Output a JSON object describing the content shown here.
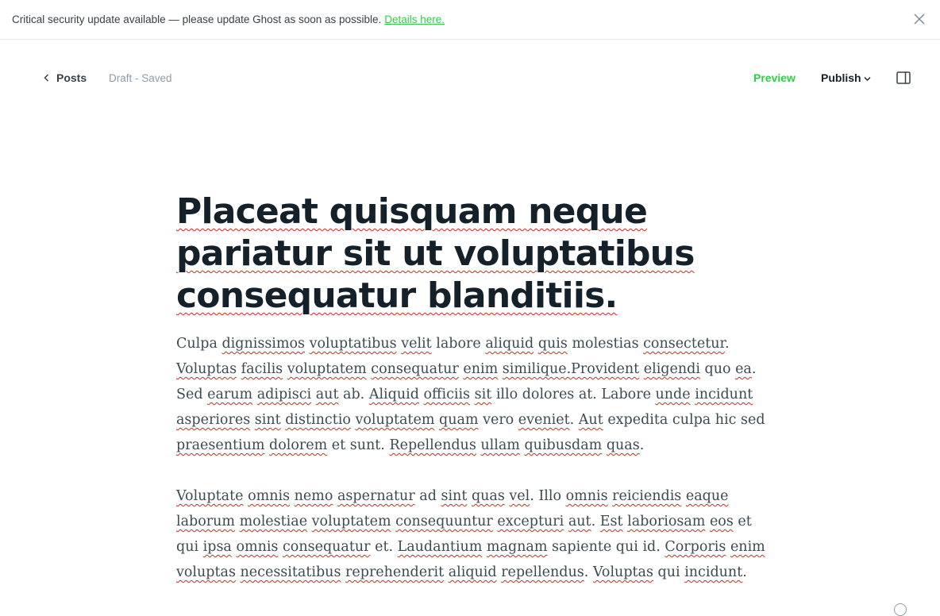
{
  "banner": {
    "message": "Critical security update available — please update Ghost as soon as possible.",
    "link_label": "Details here."
  },
  "header": {
    "back_label": "Posts",
    "status": "Draft - Saved",
    "preview_label": "Preview",
    "publish_label": "Publish"
  },
  "post": {
    "title": "Placeat quisquam neque pariatur sit ut voluptatibus consequatur blanditiis.",
    "paragraph1": [
      [
        "Culpa ",
        false
      ],
      [
        "dignissimos",
        true
      ],
      [
        " ",
        false
      ],
      [
        "voluptatibus",
        true
      ],
      [
        " ",
        false
      ],
      [
        "velit",
        true
      ],
      [
        " labore ",
        false
      ],
      [
        "aliquid",
        true
      ],
      [
        " ",
        false
      ],
      [
        "quis",
        true
      ],
      [
        " molestias ",
        false
      ],
      [
        "consectetur",
        true
      ],
      [
        ". ",
        false
      ],
      [
        "Voluptas",
        true
      ],
      [
        " ",
        false
      ],
      [
        "facilis",
        true
      ],
      [
        " ",
        false
      ],
      [
        "voluptatem",
        true
      ],
      [
        " ",
        false
      ],
      [
        "consequatur",
        true
      ],
      [
        " ",
        false
      ],
      [
        "enim",
        true
      ],
      [
        " ",
        false
      ],
      [
        "similique.Provident",
        true
      ],
      [
        " ",
        false
      ],
      [
        "eligendi",
        true
      ],
      [
        " quo ",
        false
      ],
      [
        "ea",
        true
      ],
      [
        ". Sed ",
        false
      ],
      [
        "earum",
        true
      ],
      [
        " ",
        false
      ],
      [
        "adipisci",
        true
      ],
      [
        " ",
        false
      ],
      [
        "aut",
        true
      ],
      [
        " ab. ",
        false
      ],
      [
        "Aliquid",
        true
      ],
      [
        " ",
        false
      ],
      [
        "officiis",
        true
      ],
      [
        " ",
        false
      ],
      [
        "sit",
        true
      ],
      [
        " illo dolores at. Labore ",
        false
      ],
      [
        "unde",
        true
      ],
      [
        " ",
        false
      ],
      [
        "incidunt",
        true
      ],
      [
        " ",
        false
      ],
      [
        "asperiores",
        true
      ],
      [
        " ",
        false
      ],
      [
        "sint",
        true
      ],
      [
        " ",
        false
      ],
      [
        "distinctio",
        true
      ],
      [
        " ",
        false
      ],
      [
        "voluptatem",
        true
      ],
      [
        " ",
        false
      ],
      [
        "quam",
        true
      ],
      [
        " vero ",
        false
      ],
      [
        "eveniet",
        true
      ],
      [
        ". ",
        false
      ],
      [
        "Aut",
        true
      ],
      [
        " expedita culpa hic sed ",
        false
      ],
      [
        "praesentium",
        true
      ],
      [
        " ",
        false
      ],
      [
        "dolorem",
        true
      ],
      [
        " et sunt. ",
        false
      ],
      [
        "Repellendus",
        true
      ],
      [
        " ",
        false
      ],
      [
        "ullam",
        true
      ],
      [
        " ",
        false
      ],
      [
        "quibusdam",
        true
      ],
      [
        " ",
        false
      ],
      [
        "quas",
        true
      ],
      [
        ".",
        false
      ]
    ],
    "paragraph2": [
      [
        "Voluptate",
        true
      ],
      [
        " ",
        false
      ],
      [
        "omnis",
        true
      ],
      [
        " ",
        false
      ],
      [
        "nemo",
        true
      ],
      [
        " ",
        false
      ],
      [
        "aspernatur",
        true
      ],
      [
        " ad ",
        false
      ],
      [
        "sint",
        true
      ],
      [
        " ",
        false
      ],
      [
        "quas",
        true
      ],
      [
        " ",
        false
      ],
      [
        "vel",
        true
      ],
      [
        ". Illo ",
        false
      ],
      [
        "omnis",
        true
      ],
      [
        " ",
        false
      ],
      [
        "reiciendis",
        true
      ],
      [
        " ",
        false
      ],
      [
        "eaque",
        true
      ],
      [
        " ",
        false
      ],
      [
        "laborum",
        true
      ],
      [
        " ",
        false
      ],
      [
        "molestiae",
        true
      ],
      [
        " ",
        false
      ],
      [
        "voluptatem",
        true
      ],
      [
        " ",
        false
      ],
      [
        "consequuntur",
        true
      ],
      [
        " ",
        false
      ],
      [
        "excepturi",
        true
      ],
      [
        " ",
        false
      ],
      [
        "aut",
        true
      ],
      [
        ". ",
        false
      ],
      [
        "Est",
        true
      ],
      [
        " ",
        false
      ],
      [
        "laboriosam",
        true
      ],
      [
        " ",
        false
      ],
      [
        "eos",
        true
      ],
      [
        " et qui ",
        false
      ],
      [
        "ipsa",
        true
      ],
      [
        " ",
        false
      ],
      [
        "omnis",
        true
      ],
      [
        " ",
        false
      ],
      [
        "consequatur",
        true
      ],
      [
        " et. ",
        false
      ],
      [
        "Laudantium",
        true
      ],
      [
        " ",
        false
      ],
      [
        "magnam",
        true
      ],
      [
        " sapiente qui id. ",
        false
      ],
      [
        "Corporis",
        true
      ],
      [
        " ",
        false
      ],
      [
        "enim",
        true
      ],
      [
        " ",
        false
      ],
      [
        "voluptas",
        true
      ],
      [
        " ",
        false
      ],
      [
        "necessitatibus",
        true
      ],
      [
        " ",
        false
      ],
      [
        "reprehenderit",
        true
      ],
      [
        " ",
        false
      ],
      [
        "aliquid",
        true
      ],
      [
        " ",
        false
      ],
      [
        "repellendus",
        true
      ],
      [
        ". ",
        false
      ],
      [
        "Voluptas",
        true
      ],
      [
        " qui ",
        false
      ],
      [
        "incidunt",
        true
      ],
      [
        ".",
        false
      ]
    ]
  },
  "icons": {
    "close": "close-icon",
    "back": "chevron-left-icon",
    "publish_dropdown": "chevron-down-icon",
    "sidebar": "sidebar-toggle-icon"
  },
  "colors": {
    "accent_green": "#30cf43",
    "spellcheck_red": "#e0241a",
    "muted_text": "#8e9cac"
  }
}
